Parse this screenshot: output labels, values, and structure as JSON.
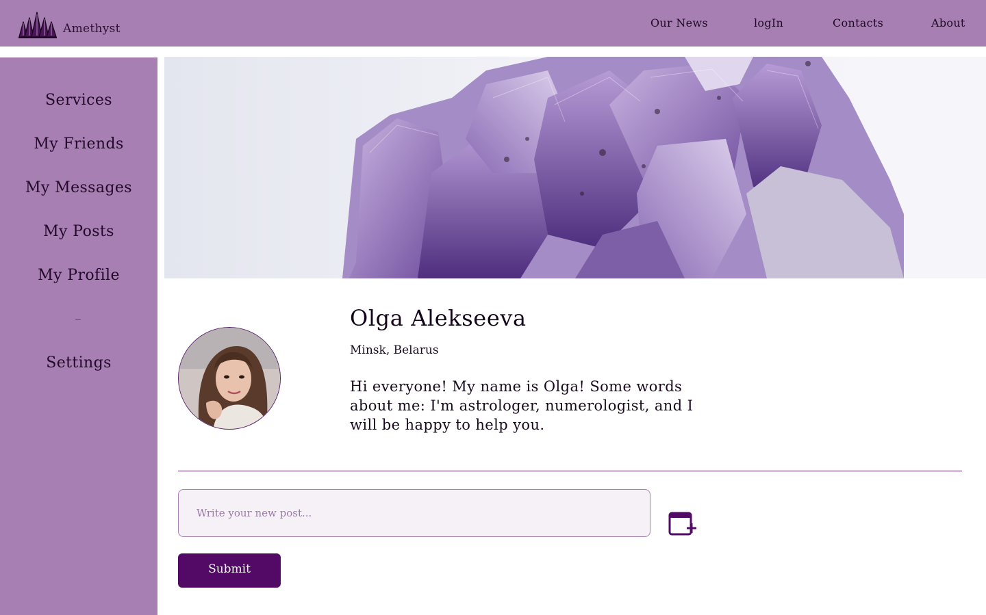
{
  "brand": {
    "name": "Amethyst",
    "logo_icon": "crystal-crown-icon"
  },
  "topnav": {
    "items": [
      {
        "label": "Our News"
      },
      {
        "label": "logIn"
      },
      {
        "label": "Contacts"
      },
      {
        "label": "About"
      }
    ]
  },
  "sidebar": {
    "items": [
      {
        "label": "Services"
      },
      {
        "label": "My Friends"
      },
      {
        "label": "My Messages"
      },
      {
        "label": "My Posts"
      },
      {
        "label": "My Profile"
      },
      {
        "label": "Settings"
      }
    ]
  },
  "banner": {
    "image": "amethyst-crystal-cluster"
  },
  "profile": {
    "name": "Olga Alekseeva",
    "location": "Minsk, Belarus",
    "bio": "Hi everyone! My name is Olga! Some words about me: I'm astrologer,  numerologist, and I will be happy to help you.",
    "avatar": "user-photo"
  },
  "composer": {
    "placeholder": "Write your new post...",
    "value": "",
    "attach_icon": "add-window-icon",
    "submit_label": "Submit"
  },
  "colors": {
    "accent": "#a77fb3",
    "primary_dark": "#520a66",
    "text": "#1a0a1f"
  }
}
